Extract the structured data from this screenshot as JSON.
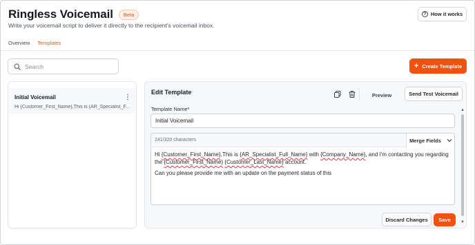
{
  "header": {
    "title": "Ringless Voicemail",
    "beta_badge": "Beta",
    "subtitle": "Write your voicemail script to deliver it directly to the recipient's voicemail inbox.",
    "how_it_works_label": "How it works"
  },
  "tabs": [
    {
      "label": "Overview",
      "active": false
    },
    {
      "label": "Templates",
      "active": true
    }
  ],
  "search": {
    "placeholder": "Search",
    "value": ""
  },
  "create_button_label": "Create Template",
  "templates": [
    {
      "title": "Initial Voicemail",
      "preview": "Hi {Customer_First_Name},This is {AR_Specialist_F..."
    }
  ],
  "editor": {
    "title": "Edit Template",
    "preview_label": "Preview",
    "send_test_label": "Send Test Voicemail",
    "name_label": "Template Name*",
    "name_value": "Initial Voicemail",
    "char_count": "241/320 characters",
    "merge_fields_label": "Merge Fields",
    "body": {
      "p1_a": "Hi ",
      "f_first": "{Customer_First_Name}",
      "p1_b": ",This is ",
      "f_ar": "{AR_Specialist_Full_Name}",
      "p1_c": " with ",
      "f_company": "{Company_Name}",
      "p1_d": ", and I'm contacting you regarding the ",
      "f_first2": "{Customer_First_Name}",
      "p1_e": " ",
      "f_last": "{Customer_Last_Name}",
      "p1_f": " account.",
      "p2": "Can you please provide me with an update on the payment status of this"
    },
    "discard_label": "Discard Changes",
    "save_label": "Save"
  },
  "colors": {
    "accent": "#f0530f",
    "beta_text": "#e4571a",
    "spell_underline": "#e03b3b"
  },
  "icons": [
    "help-icon",
    "search-icon",
    "plus-icon",
    "kebab-icon",
    "copy-icon",
    "trash-icon",
    "chevron-down-icon"
  ]
}
